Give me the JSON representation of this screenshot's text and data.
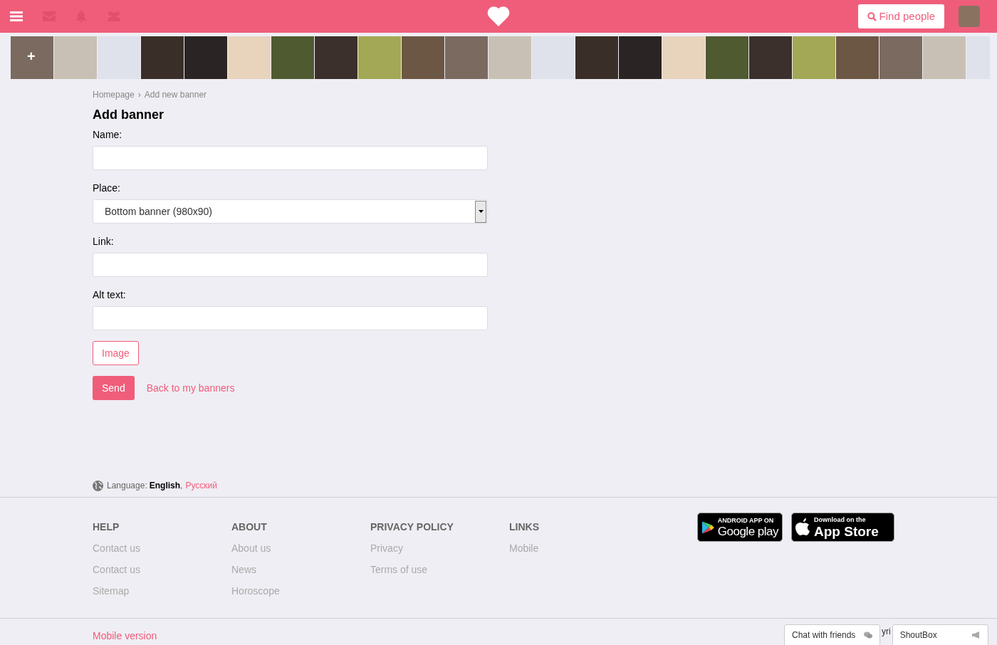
{
  "header": {
    "search_button": "Find people"
  },
  "photo_strip": [
    {
      "kind": "add",
      "overlay": "+"
    },
    {
      "kind": "photo"
    },
    {
      "kind": "photo"
    },
    {
      "kind": "photo"
    },
    {
      "kind": "photo"
    },
    {
      "kind": "photo"
    },
    {
      "kind": "photo"
    },
    {
      "kind": "photo"
    },
    {
      "kind": "photo"
    },
    {
      "kind": "photo"
    },
    {
      "kind": "photo"
    },
    {
      "kind": "photo"
    },
    {
      "kind": "photo"
    },
    {
      "kind": "photo"
    },
    {
      "kind": "photo"
    },
    {
      "kind": "photo"
    },
    {
      "kind": "photo"
    },
    {
      "kind": "photo"
    },
    {
      "kind": "photo"
    },
    {
      "kind": "photo"
    },
    {
      "kind": "photo"
    },
    {
      "kind": "photo"
    },
    {
      "kind": "photo"
    }
  ],
  "breadcrumb": [
    "Homepage",
    "Add new banner"
  ],
  "breadcrumb_separator": "›",
  "page_title": "Add banner",
  "fields": [
    {
      "kind": "text",
      "label": "Name:"
    },
    {
      "kind": "select",
      "label": "Place:",
      "value": "Bottom banner (980x90)"
    },
    {
      "kind": "text",
      "label": "Link:"
    },
    {
      "kind": "text",
      "label": "Alt text:"
    }
  ],
  "image_button": "Image",
  "send_button": "Send",
  "back_link": "Back to my banners",
  "language": {
    "label": "Language:",
    "separator": ",",
    "options": [
      {
        "label": "English",
        "selected": true
      },
      {
        "label": "Русский",
        "selected": false
      }
    ]
  },
  "footer_columns": [
    {
      "heading": "HELP",
      "links": [
        "Contact us",
        "Contact us",
        "Sitemap"
      ]
    },
    {
      "heading": "ABOUT",
      "links": [
        "About us",
        "News",
        "Horoscope"
      ]
    },
    {
      "heading": "PRIVACY POLICY",
      "links": [
        "Privacy",
        "Terms of use"
      ]
    },
    {
      "heading": "LINKS",
      "links": [
        "Mobile"
      ]
    }
  ],
  "app_badges": [
    {
      "kind": "google",
      "small": "ANDROID APP ON",
      "big": "Google play"
    },
    {
      "kind": "apple",
      "small": "Download on the",
      "big": "App Store"
    }
  ],
  "mobile_version": "Mobile version",
  "copyright_fragment": "yri",
  "chat_tabs": [
    {
      "kind": "chat",
      "label": "Chat with friends"
    },
    {
      "kind": "shout",
      "label": "ShoutBox"
    }
  ]
}
